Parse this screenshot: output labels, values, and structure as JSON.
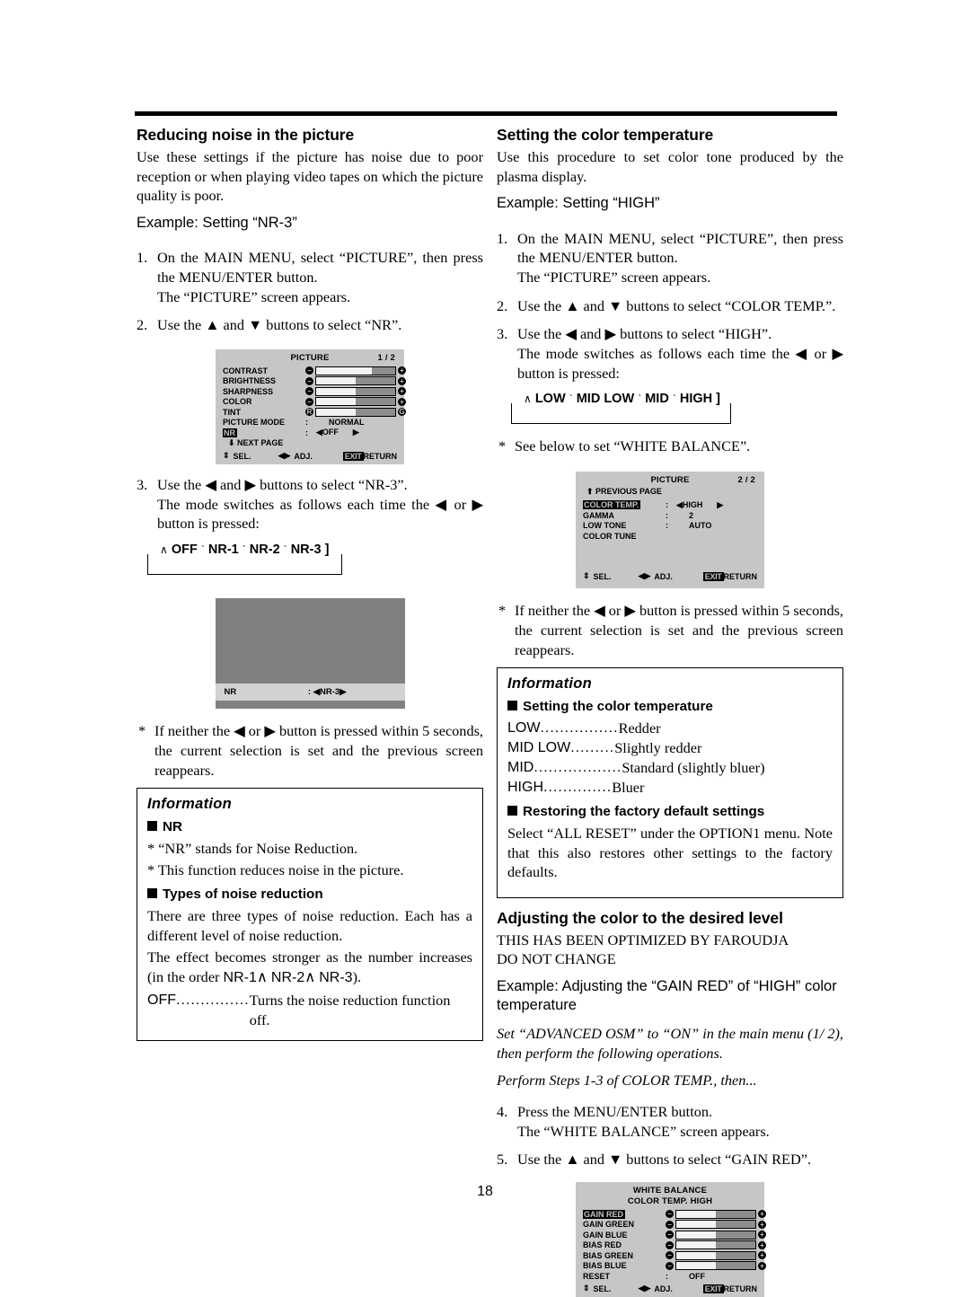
{
  "page": {
    "number": "18"
  },
  "left": {
    "heading": "Reducing noise in the picture",
    "intro": "Use these settings if the picture has noise due to poor reception or when playing video tapes on which the picture quality is poor.",
    "example": "Example: Setting “NR-3”",
    "step1": {
      "num": "1.",
      "line1": "On the MAIN MENU, select “PICTURE”, then press the MENU/ENTER button.",
      "line2": "The “PICTURE” screen appears."
    },
    "step2": {
      "num": "2.",
      "line1": "Use the ▲ and ▼ buttons to select “NR”."
    },
    "step3": {
      "num": "3.",
      "line1": "Use the ◀ and ▶ buttons to select “NR-3”.",
      "line2": "The mode switches as follows each time the ◀ or ▶ button is pressed:"
    },
    "cycle": {
      "start_arrow": "∧",
      "items": [
        "OFF",
        "NR-1",
        "NR-2",
        "NR-3"
      ],
      "separator": "`",
      "end_bracket": "]"
    },
    "timeout_note": "If neither the ◀ or ▶ button is pressed within 5 seconds, the current selection is set and the previous screen reappears.",
    "timeout_ast": "*"
  },
  "osd_picture_1": {
    "title": "PICTURE",
    "page": "1 / 2",
    "rows": [
      {
        "label": "CONTRAST",
        "type": "slider",
        "minus": "−",
        "plus": "+",
        "fill": 70
      },
      {
        "label": "BRIGHTNESS",
        "type": "slider",
        "minus": "−",
        "plus": "+",
        "fill": 50
      },
      {
        "label": "SHARPNESS",
        "type": "slider",
        "minus": "−",
        "plus": "+",
        "fill": 50
      },
      {
        "label": "COLOR",
        "type": "slider",
        "minus": "−",
        "plus": "+",
        "fill": 50
      },
      {
        "label": "TINT",
        "type": "slider",
        "minus": "R",
        "plus": "G",
        "fill": 50
      },
      {
        "label": "PICTURE MODE",
        "type": "value",
        "colon": ":",
        "value": "NORMAL"
      },
      {
        "label": "NR",
        "type": "adjust",
        "highlight": true,
        "colon": ":",
        "value": "OFF"
      }
    ],
    "next_page": "⬇  NEXT PAGE",
    "footer": {
      "sel": "SEL.",
      "adj": "ADJ.",
      "exit": "EXIT",
      "return": "RETURN"
    }
  },
  "preview": {
    "label": "NR",
    "colon": ":",
    "value": "NR-3"
  },
  "info_left": {
    "title": "Information",
    "h1": "NR",
    "p1": "“NR” stands for Noise Reduction.",
    "p2": "This function reduces noise in the picture.",
    "ast": "*",
    "h2": "Types of noise reduction",
    "p3": "There are three types of noise reduction. Each has a different level of noise reduction.",
    "p4_a": "The effect becomes stronger as the number increases (in the order ",
    "p4_nr1": "NR-1",
    "p4_arrow1": "∧",
    "p4_nr2": "NR-2",
    "p4_arrow2": "∧",
    "p4_nr3": "NR-3",
    "p4_b": ").",
    "off_key": "OFF",
    "off_dots": "...............",
    "off_val": "Turns the noise reduction function off."
  },
  "right": {
    "heading": "Setting the color temperature",
    "intro": "Use this procedure to set color tone produced by the plasma display.",
    "example": "Example: Setting “HIGH”",
    "step1": {
      "num": "1.",
      "line1": "On the MAIN MENU, select “PICTURE”, then press the MENU/ENTER button.",
      "line2": "The “PICTURE” screen appears."
    },
    "step2": {
      "num": "2.",
      "line1": "Use the ▲ and ▼ buttons to select “COLOR TEMP.”."
    },
    "step3": {
      "num": "3.",
      "line1": "Use the ◀ and ▶ buttons to select “HIGH”.",
      "line2": "The mode switches as follows each time the ◀ or ▶ button is pressed:"
    },
    "cycle": {
      "start_arrow": "∧",
      "items": [
        "LOW",
        "MID LOW",
        "MID",
        "HIGH"
      ],
      "separator": "`",
      "end_bracket": "]"
    },
    "see_below_ast": "*",
    "see_below": "See below to set “WHITE BALANCE”.",
    "timeout_ast": "*",
    "timeout_note": "If neither the ◀ or ▶ button is pressed within 5 seconds, the current selection is set and the previous screen reappears."
  },
  "osd_picture_2": {
    "title": "PICTURE",
    "page": "2 / 2",
    "previous_page": "⬆  PREVIOUS PAGE",
    "rows": [
      {
        "label": "COLOR TEMP.",
        "type": "adjust",
        "highlight": true,
        "colon": ":",
        "value": "HIGH"
      },
      {
        "label": "GAMMA",
        "type": "value",
        "colon": ":",
        "value": "2"
      },
      {
        "label": "LOW TONE",
        "type": "value",
        "colon": ":",
        "value": "AUTO"
      },
      {
        "label": "COLOR TUNE",
        "type": "plain",
        "colon": "",
        "value": ""
      }
    ],
    "footer": {
      "sel": "SEL.",
      "adj": "ADJ.",
      "exit": "EXIT",
      "return": "RETURN"
    }
  },
  "info_right": {
    "title": "Information",
    "h1": "Setting the color temperature",
    "defs": [
      {
        "k": "LOW",
        "dots": "................",
        "v": "Redder"
      },
      {
        "k": "MID LOW",
        "dots": ".........",
        "v": "Slightly redder"
      },
      {
        "k": "MID",
        "dots": "..................",
        "v": "Standard (slightly bluer)"
      },
      {
        "k": "HIGH",
        "dots": "..............",
        "v": "Bluer"
      }
    ],
    "h2": "Restoring the factory default settings",
    "p1": "Select “ALL RESET” under the OPTION1 menu. Note that this also restores other settings to the factory defaults."
  },
  "right_bottom": {
    "heading": "Adjusting the color to the desired level",
    "caps1": "THIS HAS BEEN OPTIMIZED BY FAROUDJA",
    "caps2": "DO NOT CHANGE",
    "example": "Example: Adjusting the “GAIN RED” of “HIGH” color temperature",
    "italic1": "Set “ADVANCED OSM” to “ON” in the main menu (1/ 2), then perform the following operations.",
    "italic2": "Perform Steps 1-3 of COLOR  TEMP., then...",
    "step4": {
      "num": "4.",
      "line1": "Press the MENU/ENTER button.",
      "line2": "The “WHITE BALANCE” screen appears."
    },
    "step5": {
      "num": "5.",
      "line1": "Use the ▲ and ▼ buttons to select “GAIN RED”."
    }
  },
  "osd_white_balance": {
    "title": "WHITE BALANCE",
    "subtitle": "COLOR TEMP. HIGH",
    "rows": [
      {
        "label": "GAIN RED",
        "type": "slider",
        "highlight": true,
        "minus": "−",
        "plus": "+",
        "fill": 50
      },
      {
        "label": "GAIN GREEN",
        "type": "slider",
        "highlight": false,
        "minus": "−",
        "plus": "+",
        "fill": 50
      },
      {
        "label": "GAIN BLUE",
        "type": "slider",
        "highlight": false,
        "minus": "−",
        "plus": "+",
        "fill": 50
      },
      {
        "label": "BIAS RED",
        "type": "slider",
        "highlight": false,
        "minus": "−",
        "plus": "+",
        "fill": 50
      },
      {
        "label": "BIAS GREEN",
        "type": "slider",
        "highlight": false,
        "minus": "−",
        "plus": "+",
        "fill": 50
      },
      {
        "label": "BIAS BLUE",
        "type": "slider",
        "highlight": false,
        "minus": "−",
        "plus": "+",
        "fill": 50
      },
      {
        "label": "RESET",
        "type": "value",
        "colon": ":",
        "value": "OFF"
      }
    ],
    "footer": {
      "sel": "SEL.",
      "adj": "ADJ.",
      "exit": "EXIT",
      "return": "RETURN"
    }
  }
}
